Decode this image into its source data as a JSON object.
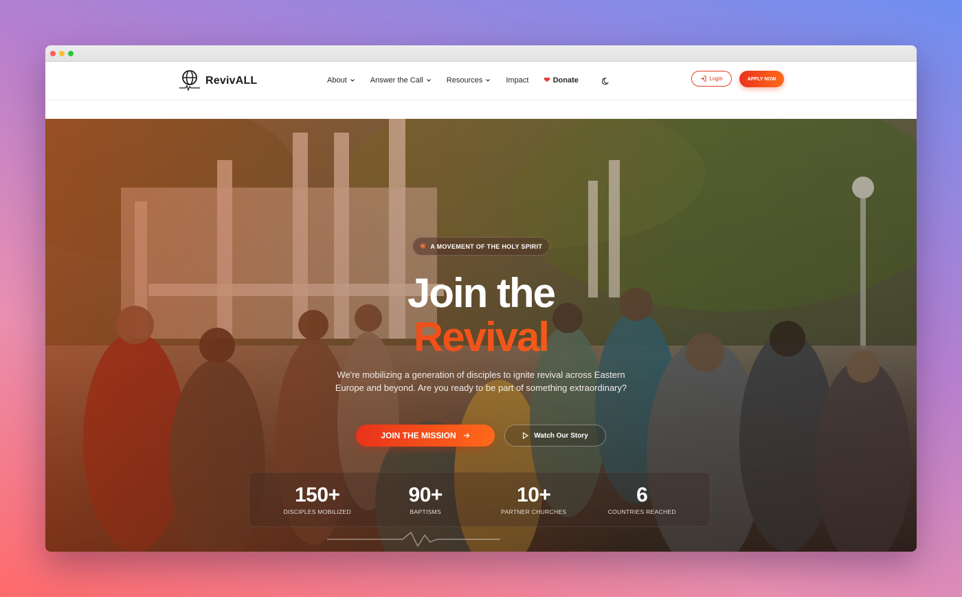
{
  "brand": {
    "name": "RevivALL"
  },
  "nav": {
    "items": [
      {
        "label": "About",
        "has_dropdown": true
      },
      {
        "label": "Answer the Call",
        "has_dropdown": true
      },
      {
        "label": "Resources",
        "has_dropdown": true
      },
      {
        "label": "Impact",
        "has_dropdown": false
      }
    ],
    "donate_label": "Donate",
    "login_label": "Login",
    "apply_label": "APPLY NOW"
  },
  "hero": {
    "badge": "A MOVEMENT OF THE HOLY SPIRIT",
    "headline_line1": "Join the",
    "headline_line2": "Revival",
    "subtext": "We're mobilizing a generation of disciples to ignite revival across Eastern Europe and beyond. Are you ready to be part of something extraordinary?",
    "primary_cta": "JOIN THE MISSION",
    "secondary_cta": "Watch Our Story"
  },
  "stats": [
    {
      "value": "150+",
      "label": "DISCIPLES MOBILIZED"
    },
    {
      "value": "90+",
      "label": "BAPTISMS"
    },
    {
      "value": "10+",
      "label": "PARTNER CHURCHES"
    },
    {
      "value": "6",
      "label": "COUNTRIES REACHED"
    }
  ],
  "colors": {
    "accent": "#e9321b",
    "accent_end": "#ff6a1a",
    "heart": "#e6393a"
  },
  "icons": {
    "logo": "globe-pulse-icon",
    "theme_toggle": "moon-icon",
    "badge": "sparkle-icon"
  }
}
